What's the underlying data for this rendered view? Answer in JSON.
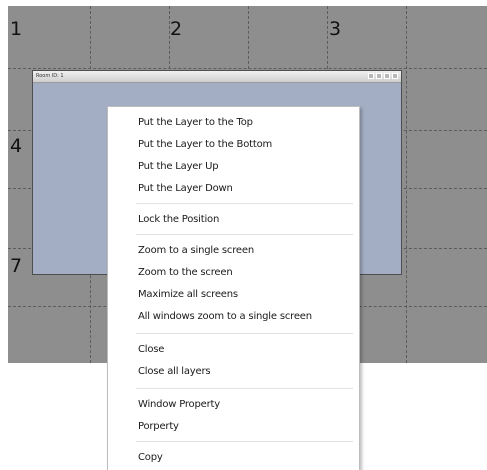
{
  "grid": {
    "cell_numbers": [
      "1",
      "2",
      "3",
      "4",
      "7"
    ]
  },
  "layer_window": {
    "title": "Room ID: 1",
    "controls": [
      "restore-icon",
      "maximize-icon",
      "minimize-icon",
      "close-icon"
    ]
  },
  "context_menu": {
    "items": [
      "Put the Layer to the Top",
      "Put the Layer to the Bottom",
      "Put the Layer Up",
      "Put the Layer Down",
      "Lock the Position",
      "Zoom to a single screen",
      "Zoom to the screen",
      "Maximize all screens",
      "All windows zoom to a single screen",
      "Close",
      "Close all layers",
      "Window Property",
      "Porperty",
      "Copy"
    ]
  }
}
